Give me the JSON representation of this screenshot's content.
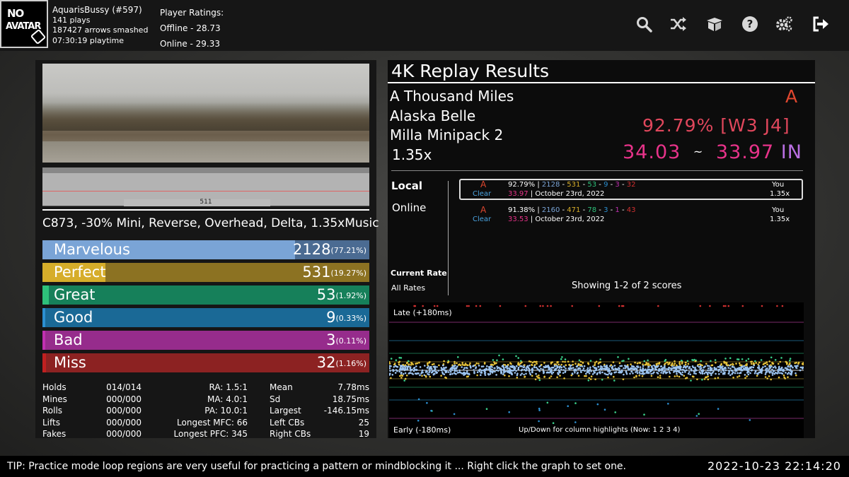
{
  "player": {
    "avatar_line1": "NO",
    "avatar_line2": "AVATAR",
    "name": "AquarisBussy (#597)",
    "plays": "141 plays",
    "arrows": "187427 arrows smashed",
    "playtime": "07:30:19 playtime",
    "ratings_title": "Player Ratings:",
    "offline": "Offline - 28.73",
    "online": "Online - 29.33"
  },
  "toolbar_icons": [
    "search-icon",
    "shuffle-icon",
    "package-icon",
    "help-icon",
    "settings-icon",
    "exit-icon"
  ],
  "progress_value": "511",
  "mods": "C873, -30% Mini, Reverse, Overhead, Delta, 1.35xMusic",
  "judgments": [
    {
      "label": "Marvelous",
      "count": "2128",
      "pct": "(77.21%)",
      "fraction": 0.7721,
      "bar": "#7aa4d6",
      "bg": "#4b6b92"
    },
    {
      "label": "Perfect",
      "count": "531",
      "pct": "(19.27%)",
      "fraction": 0.1927,
      "bar": "#d6ad2a",
      "bg": "#8c7222"
    },
    {
      "label": "Great",
      "count": "53",
      "pct": "(1.92%)",
      "fraction": 0.0192,
      "bar": "#2ec07a",
      "bg": "#16805a"
    },
    {
      "label": "Good",
      "count": "9",
      "pct": "(0.33%)",
      "fraction": 0.0033,
      "bar": "#2c8fd0",
      "bg": "#1a6996"
    },
    {
      "label": "Bad",
      "count": "3",
      "pct": "(0.11%)",
      "fraction": 0.0011,
      "bar": "#c030b0",
      "bg": "#962c8c"
    },
    {
      "label": "Miss",
      "count": "32",
      "pct": "(1.16%)",
      "fraction": 0.0116,
      "bar": "#c02020",
      "bg": "#8c2222"
    }
  ],
  "stats": {
    "col1": [
      [
        "Holds",
        "014/014"
      ],
      [
        "Mines",
        "000/000"
      ],
      [
        "Rolls",
        "000/000"
      ],
      [
        "Lifts",
        "000/000"
      ],
      [
        "Fakes",
        "000/000"
      ]
    ],
    "col2": [
      "RA: 1.5:1",
      "MA: 4.0:1",
      "PA: 10.0:1",
      "Longest MFC: 66",
      "Longest PFC: 345"
    ],
    "col3": [
      [
        "Mean",
        "7.78ms"
      ],
      [
        "Sd",
        "18.75ms"
      ],
      [
        "Largest",
        "-146.15ms"
      ],
      [
        "Left CBs",
        "25"
      ],
      [
        "Right CBs",
        "19"
      ]
    ]
  },
  "results": {
    "header": "4K Replay Results",
    "song": "A Thousand Miles",
    "artist": "Alaska Belle",
    "pack": "Milla Minipack 2",
    "rate": "1.35x",
    "grade": "A",
    "score": "92.79%",
    "judge": "[W3 J4]",
    "msd": "34.03",
    "tilde": "~",
    "ssr": "33.97",
    "skillset": "IN"
  },
  "scoreboard": {
    "tab_local": "Local",
    "tab_online": "Online",
    "filter_rate": "Current Rate",
    "filter_all": "All Rates",
    "showing": "Showing 1-2 of 2 scores",
    "entries": [
      {
        "grade": "A",
        "clear": "Clear",
        "pct": "92.79%",
        "sep": " | ",
        "j": [
          "2128",
          "531",
          "53",
          "9",
          "3",
          "32"
        ],
        "ssr": "33.97",
        "date": " | October 23rd, 2022",
        "who": "You",
        "rate": "1.35x"
      },
      {
        "grade": "A",
        "clear": "Clear",
        "pct": "91.38%",
        "sep": " | ",
        "j": [
          "2160",
          "471",
          "78",
          "3",
          "1",
          "43"
        ],
        "ssr": "33.53",
        "date": " | October 23rd, 2022",
        "who": "You",
        "rate": "1.35x"
      }
    ]
  },
  "graph": {
    "late": "Late (+180ms)",
    "early": "Early (-180ms)",
    "hint": "Up/Down for column highlights (Now: 1 2 3 4)"
  },
  "footer": {
    "tip": "TIP: Practice mode loop regions are very useful for practicing a pattern or mindblocking it ... Right click the graph to set one.",
    "datetime": "2022-10-23 22:14:20"
  },
  "colors": {
    "grade": "#e0472f",
    "score": "#e0475c",
    "msd": "#e8338a",
    "skillset": "#b86ee0",
    "accent": "#ffffff"
  }
}
